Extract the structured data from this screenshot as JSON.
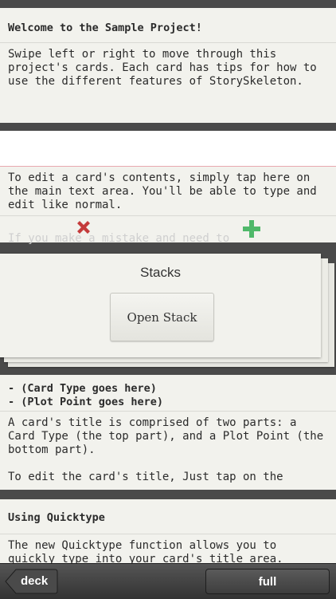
{
  "card1": {
    "title": "Welcome to the Sample Project!",
    "body": "Swipe left or right to move through this project's cards. Each card has tips for how to use the different features of StorySkeleton."
  },
  "card2": {
    "title": "",
    "body": "To edit a card's contents, simply tap here on the main text area. You'll be able to type and edit like normal.",
    "faded_line": "If you make a mistake and need to"
  },
  "stacks": {
    "title": "Stacks",
    "open_label": "Open Stack"
  },
  "card3": {
    "title_line1": "- (Card Type goes here)",
    "title_line2": "- (Plot Point goes here)",
    "body": "A card's title is comprised of two parts: a Card Type (the top part), and a Plot Point (the bottom part).\n\nTo edit the card's title, Just tap on the"
  },
  "card4": {
    "title": "Using Quicktype",
    "body": "The new Quicktype function allows you to quickly type into your card's title area."
  },
  "toolbar": {
    "deck_label": "deck",
    "full_label": "full"
  },
  "icons": {
    "delete": "x-icon",
    "add": "plus-icon",
    "back": "back-arrow-icon"
  },
  "colors": {
    "delete": "#c43b3b",
    "add": "#4fb86a",
    "card": "#f2f2ed",
    "background": "#4a4a4a"
  }
}
